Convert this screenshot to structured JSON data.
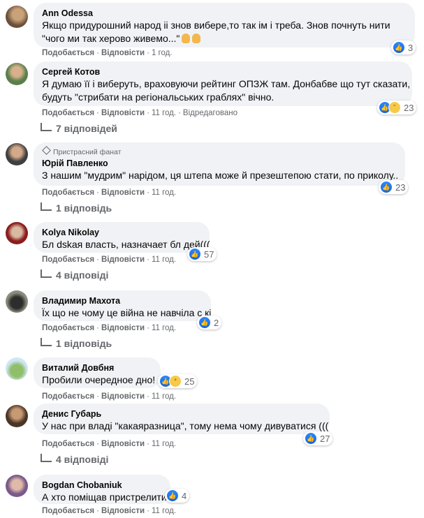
{
  "labels": {
    "like": "Подобається",
    "reply": "Відповісти",
    "edited": "Відредаговано"
  },
  "comments": [
    {
      "name": "Ann Odessa",
      "text1": "Якщо придурошний народ іі знов вибере,то так ім і треба. Знов почнуть нити",
      "text2": "\"чого ми так херово живемо...\"",
      "time": "1 год.",
      "reactions": "3"
    },
    {
      "name": "Сергей Котов",
      "text1": "Я думаю її і виберуть, враховуючи рейтинг ОПЗЖ там. Донбабве що тут сказати,",
      "text2": "будуть \"стрибати на регіональських граблях\" вічно.",
      "time": "11 год.",
      "reactions": "23",
      "replies": "7 відповідей"
    },
    {
      "badge": "Пристрасний фанат",
      "name": "Юрій Павленко",
      "text1": "З нашим \"мудрим\" нарідом, ця штепа може й презештепою стати, по приколу..",
      "time": "11 год.",
      "reactions": "23",
      "replies": "1 відповідь"
    },
    {
      "name": "Kolya Nikolay",
      "text1": "Бл   dskая власть, назначает бл   дей(((",
      "time": "11 год.",
      "reactions": "57",
      "replies": "4 відповіді"
    },
    {
      "name": "Владимир Махота",
      "text1": "Їх що не чому це війна не навчіла с   кі",
      "time": "11 год.",
      "reactions": "2",
      "replies": "1 відповідь"
    },
    {
      "name": "Виталий Довбня",
      "text1": "Пробили очередное дно!",
      "time": "11 год.",
      "reactions": "25"
    },
    {
      "name": "Денис Губарь",
      "text1": "У нас при владі \"какаяразница\", тому нема чому дивуватися (((",
      "time": "11 год.",
      "reactions": "27",
      "replies": "4 відповіді"
    },
    {
      "name": "Bogdan Chobaniuk",
      "text1": "А хто поміщав пристрелити",
      "time": "11 год.",
      "reactions": "4"
    }
  ]
}
